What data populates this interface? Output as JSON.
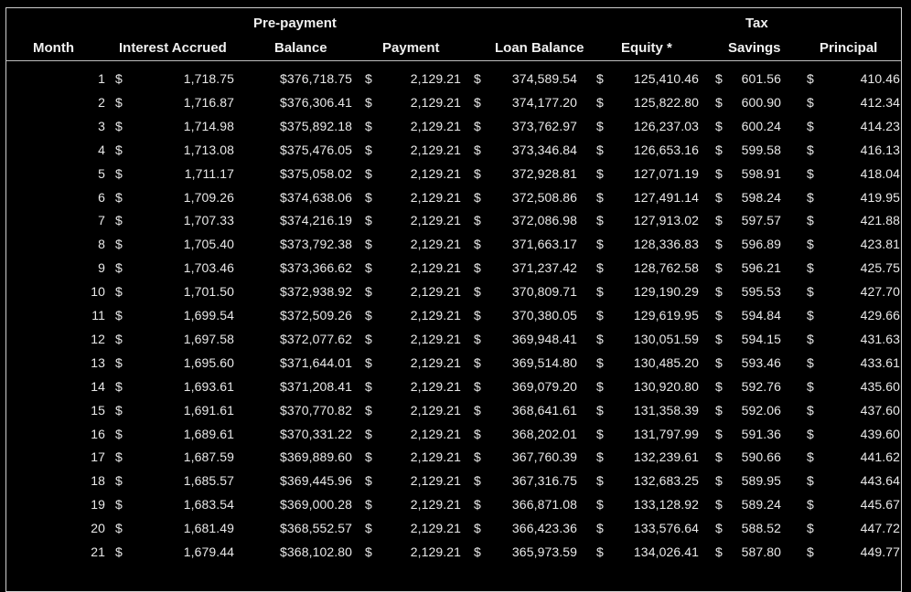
{
  "table": {
    "headers": {
      "month": "Month",
      "interest": "Interest Accrued",
      "prepay_line1": "Pre-payment",
      "prepay_line2": "Balance",
      "payment": "Payment",
      "loan_balance": "Loan Balance",
      "equity": "Equity *",
      "tax_line1": "Tax",
      "tax_line2": "Savings",
      "principal": "Principal"
    },
    "currency_symbol": "$",
    "rows": [
      {
        "month": "1",
        "interest": "1,718.75",
        "prepay": "$376,718.75",
        "payment": "2,129.21",
        "loan": "374,589.54",
        "equity": "125,410.46",
        "tax": "601.56",
        "principal": "410.46"
      },
      {
        "month": "2",
        "interest": "1,716.87",
        "prepay": "$376,306.41",
        "payment": "2,129.21",
        "loan": "374,177.20",
        "equity": "125,822.80",
        "tax": "600.90",
        "principal": "412.34"
      },
      {
        "month": "3",
        "interest": "1,714.98",
        "prepay": "$375,892.18",
        "payment": "2,129.21",
        "loan": "373,762.97",
        "equity": "126,237.03",
        "tax": "600.24",
        "principal": "414.23"
      },
      {
        "month": "4",
        "interest": "1,713.08",
        "prepay": "$375,476.05",
        "payment": "2,129.21",
        "loan": "373,346.84",
        "equity": "126,653.16",
        "tax": "599.58",
        "principal": "416.13"
      },
      {
        "month": "5",
        "interest": "1,711.17",
        "prepay": "$375,058.02",
        "payment": "2,129.21",
        "loan": "372,928.81",
        "equity": "127,071.19",
        "tax": "598.91",
        "principal": "418.04"
      },
      {
        "month": "6",
        "interest": "1,709.26",
        "prepay": "$374,638.06",
        "payment": "2,129.21",
        "loan": "372,508.86",
        "equity": "127,491.14",
        "tax": "598.24",
        "principal": "419.95"
      },
      {
        "month": "7",
        "interest": "1,707.33",
        "prepay": "$374,216.19",
        "payment": "2,129.21",
        "loan": "372,086.98",
        "equity": "127,913.02",
        "tax": "597.57",
        "principal": "421.88"
      },
      {
        "month": "8",
        "interest": "1,705.40",
        "prepay": "$373,792.38",
        "payment": "2,129.21",
        "loan": "371,663.17",
        "equity": "128,336.83",
        "tax": "596.89",
        "principal": "423.81"
      },
      {
        "month": "9",
        "interest": "1,703.46",
        "prepay": "$373,366.62",
        "payment": "2,129.21",
        "loan": "371,237.42",
        "equity": "128,762.58",
        "tax": "596.21",
        "principal": "425.75"
      },
      {
        "month": "10",
        "interest": "1,701.50",
        "prepay": "$372,938.92",
        "payment": "2,129.21",
        "loan": "370,809.71",
        "equity": "129,190.29",
        "tax": "595.53",
        "principal": "427.70"
      },
      {
        "month": "11",
        "interest": "1,699.54",
        "prepay": "$372,509.26",
        "payment": "2,129.21",
        "loan": "370,380.05",
        "equity": "129,619.95",
        "tax": "594.84",
        "principal": "429.66"
      },
      {
        "month": "12",
        "interest": "1,697.58",
        "prepay": "$372,077.62",
        "payment": "2,129.21",
        "loan": "369,948.41",
        "equity": "130,051.59",
        "tax": "594.15",
        "principal": "431.63"
      },
      {
        "month": "13",
        "interest": "1,695.60",
        "prepay": "$371,644.01",
        "payment": "2,129.21",
        "loan": "369,514.80",
        "equity": "130,485.20",
        "tax": "593.46",
        "principal": "433.61"
      },
      {
        "month": "14",
        "interest": "1,693.61",
        "prepay": "$371,208.41",
        "payment": "2,129.21",
        "loan": "369,079.20",
        "equity": "130,920.80",
        "tax": "592.76",
        "principal": "435.60"
      },
      {
        "month": "15",
        "interest": "1,691.61",
        "prepay": "$370,770.82",
        "payment": "2,129.21",
        "loan": "368,641.61",
        "equity": "131,358.39",
        "tax": "592.06",
        "principal": "437.60"
      },
      {
        "month": "16",
        "interest": "1,689.61",
        "prepay": "$370,331.22",
        "payment": "2,129.21",
        "loan": "368,202.01",
        "equity": "131,797.99",
        "tax": "591.36",
        "principal": "439.60"
      },
      {
        "month": "17",
        "interest": "1,687.59",
        "prepay": "$369,889.60",
        "payment": "2,129.21",
        "loan": "367,760.39",
        "equity": "132,239.61",
        "tax": "590.66",
        "principal": "441.62"
      },
      {
        "month": "18",
        "interest": "1,685.57",
        "prepay": "$369,445.96",
        "payment": "2,129.21",
        "loan": "367,316.75",
        "equity": "132,683.25",
        "tax": "589.95",
        "principal": "443.64"
      },
      {
        "month": "19",
        "interest": "1,683.54",
        "prepay": "$369,000.28",
        "payment": "2,129.21",
        "loan": "366,871.08",
        "equity": "133,128.92",
        "tax": "589.24",
        "principal": "445.67"
      },
      {
        "month": "20",
        "interest": "1,681.49",
        "prepay": "$368,552.57",
        "payment": "2,129.21",
        "loan": "366,423.36",
        "equity": "133,576.64",
        "tax": "588.52",
        "principal": "447.72"
      },
      {
        "month": "21",
        "interest": "1,679.44",
        "prepay": "$368,102.80",
        "payment": "2,129.21",
        "loan": "365,973.59",
        "equity": "134,026.41",
        "tax": "587.80",
        "principal": "449.77"
      }
    ]
  }
}
